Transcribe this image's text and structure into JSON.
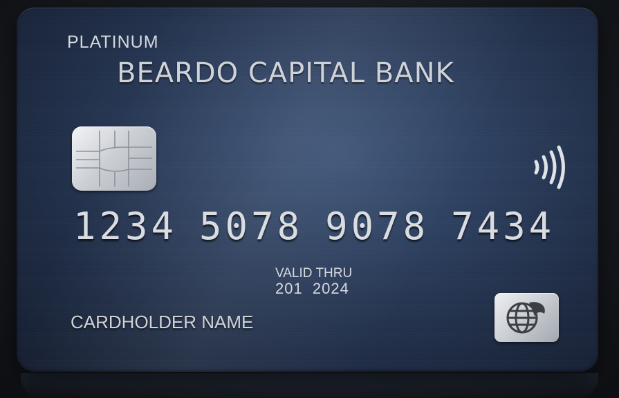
{
  "card": {
    "tier": "PLATINUM",
    "bank_name": "BEARDO CAPITAL BANK",
    "number_groups": [
      "1234",
      "5078",
      "9078",
      "7434"
    ],
    "valid_thru_label": "VALID THRU",
    "valid_thru_value": "201  2024",
    "cardholder_name": "CARDHOLDER NAME",
    "icons": {
      "chip": "emv-chip-icon",
      "contactless": "contactless-icon",
      "network": "globe-network-logo-icon"
    },
    "colors": {
      "card_base": "#2b3d5c",
      "card_dark": "#141d2f",
      "silver": "#d7dadf"
    }
  }
}
